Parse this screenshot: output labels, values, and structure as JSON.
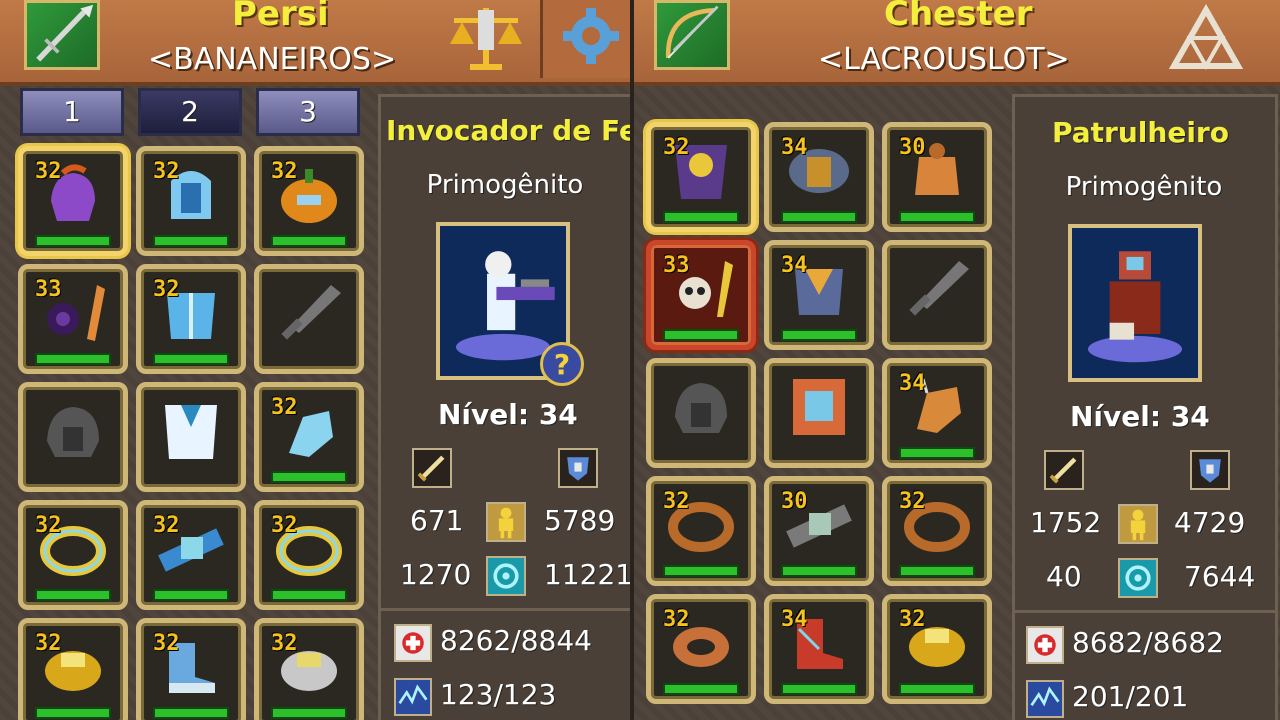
{
  "left": {
    "player_name": "Persi",
    "guild": "<BANANEIROS>",
    "tabs": [
      "1",
      "2",
      "3"
    ],
    "active_tab": "2",
    "slot_levels": [
      "32",
      "32",
      "32",
      "33",
      "32",
      "",
      "",
      "",
      "32",
      "32",
      "32",
      "32",
      "32",
      "32",
      "32"
    ],
    "class_name": "Invocador de Fe",
    "rank": "Primogênito",
    "level": "Nível: 34",
    "stats": {
      "attack": "671",
      "defense": "5789",
      "magic": "1270",
      "mana_stat": "11221"
    },
    "hp": "8262/8844",
    "mp": "123/123",
    "help_badge": "?"
  },
  "right": {
    "player_name": "Chester",
    "guild": "<LACROUSLOT>",
    "slot_levels": [
      "32",
      "34",
      "30",
      "33",
      "34",
      "",
      "",
      "",
      "34",
      "32",
      "30",
      "32",
      "32",
      "34",
      "32"
    ],
    "class_name": "Patrulheiro",
    "rank": "Primogênito",
    "level": "Nível: 34",
    "stats": {
      "attack": "1752",
      "defense": "4729",
      "magic": "40",
      "mana_stat": "7644"
    },
    "hp": "8682/8682",
    "mp": "201/201"
  },
  "colors": {
    "name": "#f4ee3c",
    "header": "#b06a3e",
    "bar": "#2cc12c",
    "frame": "#cfb777"
  },
  "icons": [
    "spear-class-icon",
    "scales-icon",
    "settings-gear-icon",
    "bow-class-icon",
    "triangle-icon",
    "sword-icon",
    "shield-icon",
    "body-icon",
    "mana-icon",
    "health-icon",
    "mp-icon"
  ]
}
